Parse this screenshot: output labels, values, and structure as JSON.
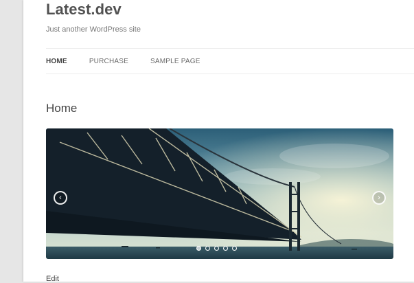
{
  "site": {
    "title": "Latest.dev",
    "description": "Just another WordPress site"
  },
  "nav": {
    "items": [
      {
        "label": "HOME",
        "current": true
      },
      {
        "label": "PURCHASE",
        "current": false
      },
      {
        "label": "SAMPLE PAGE",
        "current": false
      }
    ]
  },
  "page": {
    "title": "Home",
    "edit_label": "Edit"
  },
  "slider": {
    "prev_icon": "chevron-left-icon",
    "next_icon": "chevron-right-icon",
    "slide_count": 5,
    "active_slide": 1
  }
}
